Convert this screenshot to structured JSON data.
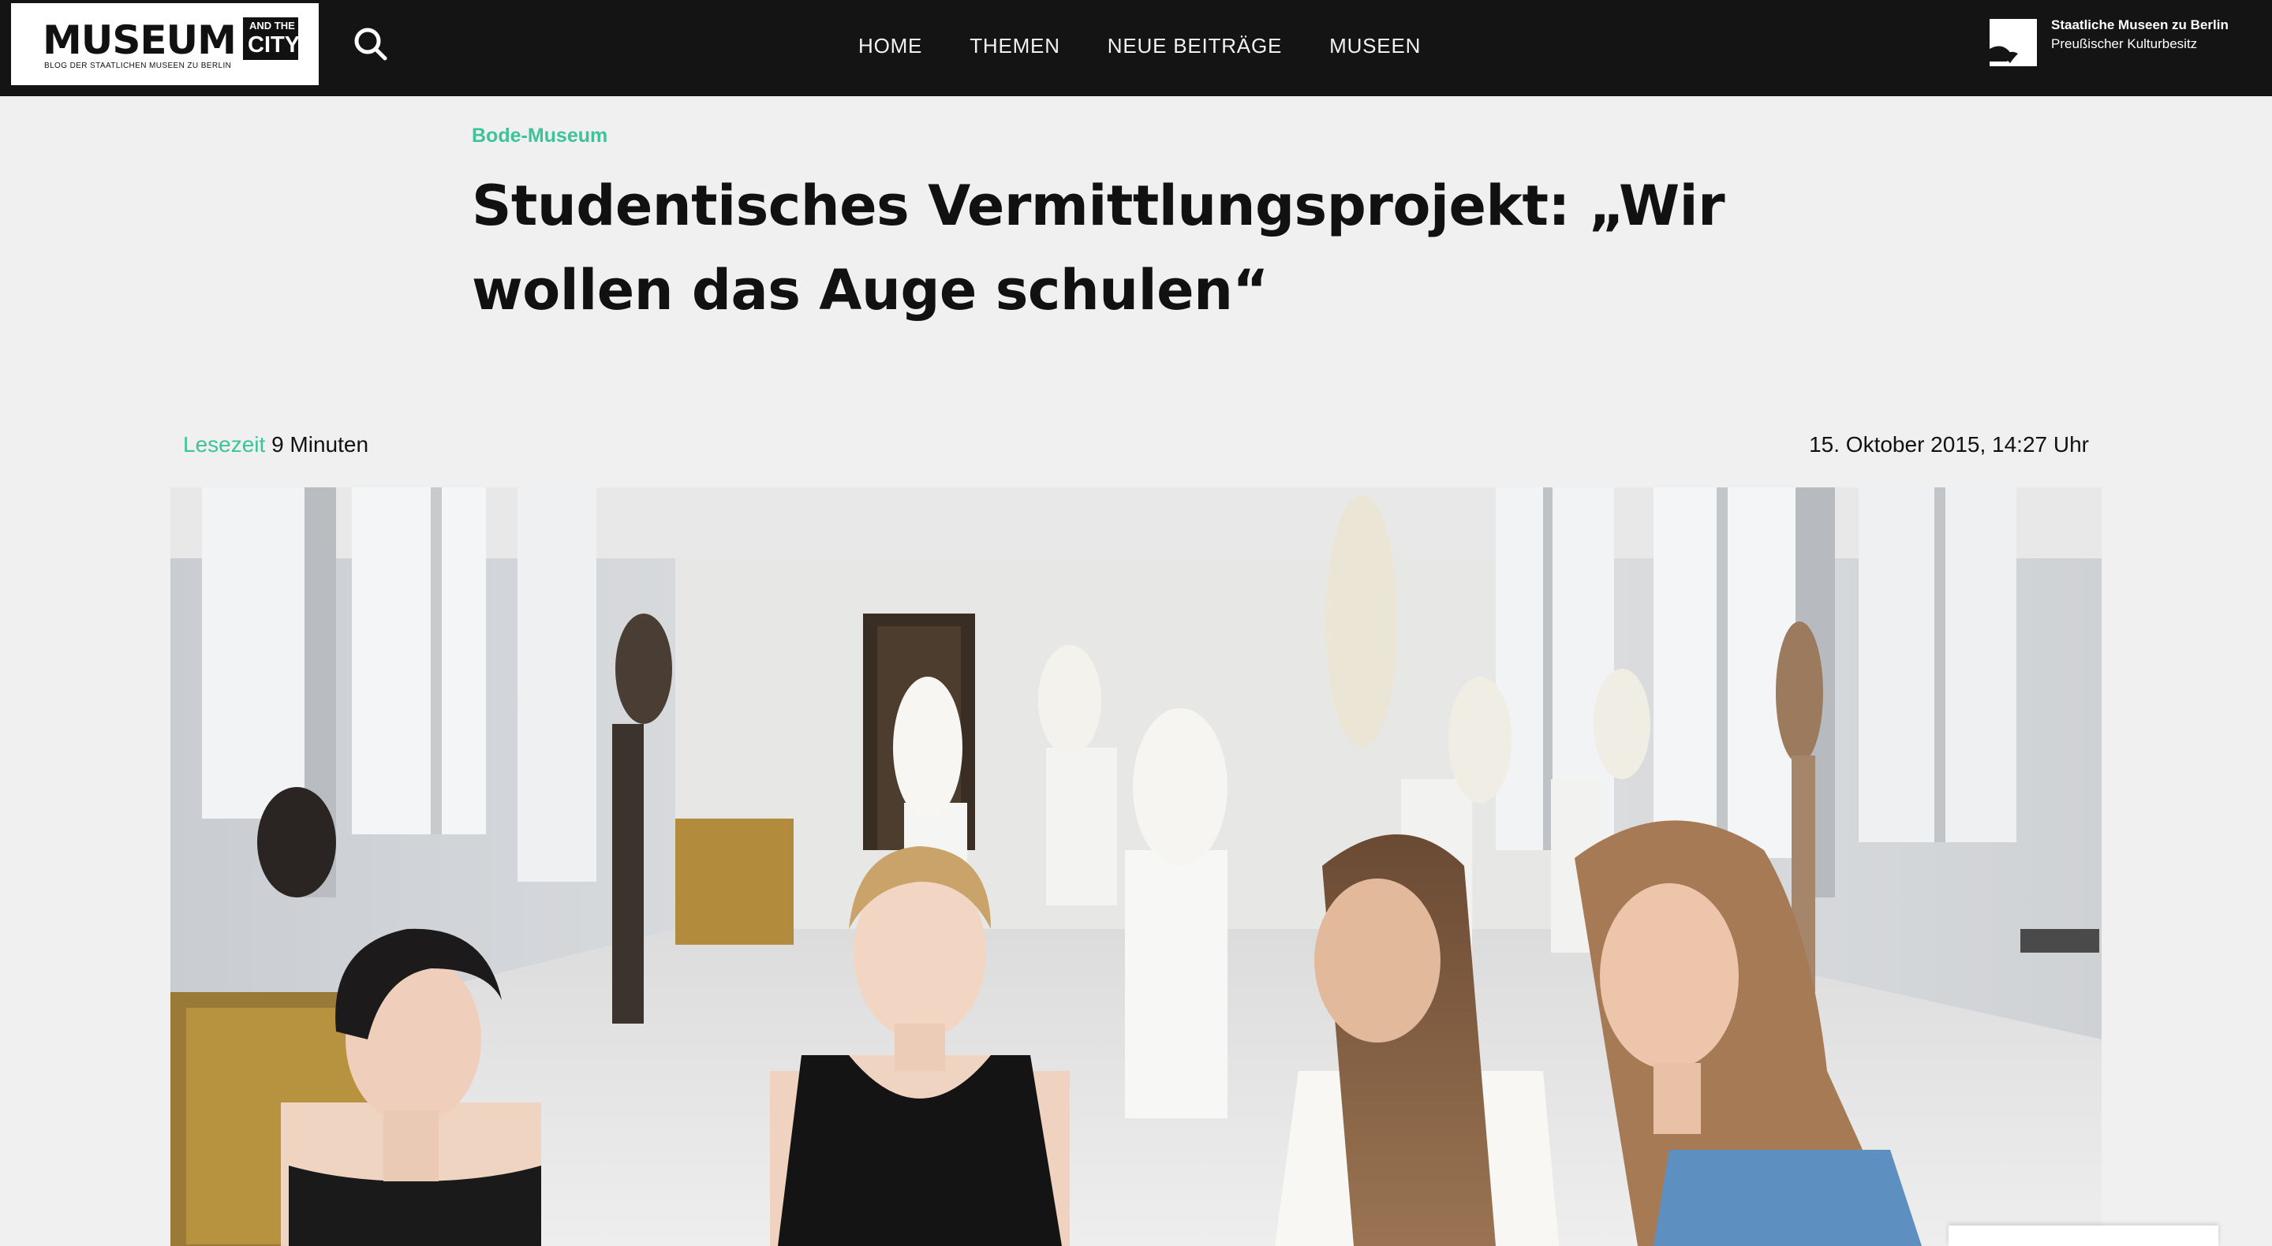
{
  "header": {
    "logo": {
      "word": "MUSEUM",
      "and_the": "AND THE",
      "city": "CITY",
      "tagline": "BLOG DER STAATLICHEN MUSEEN ZU BERLIN"
    },
    "search_icon": "search-icon",
    "nav": [
      {
        "label": "HOME"
      },
      {
        "label": "THEMEN"
      },
      {
        "label": "NEUE BEITRÄGE"
      },
      {
        "label": "MUSEEN"
      }
    ],
    "partner": {
      "line1": "Staatliche Museen zu Berlin",
      "line2": "Preußischer Kulturbesitz"
    }
  },
  "article": {
    "category": "Bode-Museum",
    "title": "Studentisches Vermittlungsprojekt: „Wir wollen das Auge schulen“",
    "reading_time_label": "Lesezeit",
    "reading_time_value": "9 Minuten",
    "date": "15. Oktober 2015, 14:27 Uhr"
  },
  "colors": {
    "accent": "#3ec29a",
    "header_bg": "#141414",
    "page_bg": "#f0f0f0"
  }
}
